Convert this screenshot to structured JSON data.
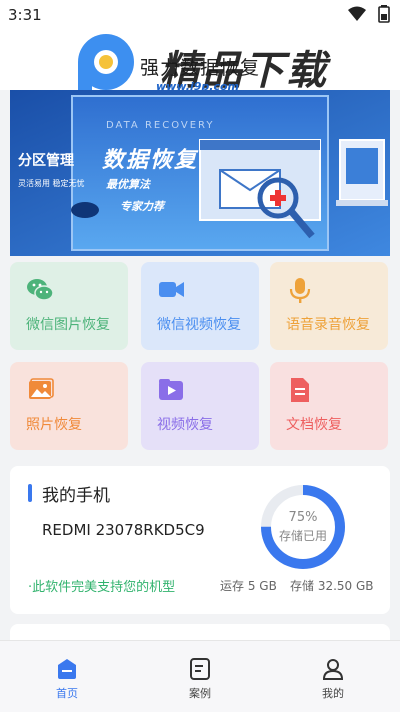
{
  "status_bar": {
    "time": "3:31"
  },
  "header": {
    "title": "强力数据恢复",
    "watermark_text": "精品下载",
    "watermark_url": "www.j9p.com"
  },
  "banner": {
    "title": "数据恢复",
    "subtitle": "DATA RECOVERY",
    "line1": "最优算法",
    "line2": "专家力荐",
    "left_text": "分区管理",
    "left_sub": "灵活易用 稳定无忧"
  },
  "tiles": [
    {
      "label": "微信图片恢复",
      "icon": "wechat-icon",
      "color": "#4db37a",
      "bg": "#dff0e6"
    },
    {
      "label": "微信视频恢复",
      "icon": "video-camera-icon",
      "color": "#4a8ef0",
      "bg": "#dbe7fa"
    },
    {
      "label": "语音录音恢复",
      "icon": "microphone-icon",
      "color": "#eea23a",
      "bg": "#f7ead8"
    },
    {
      "label": "照片恢复",
      "icon": "photo-icon",
      "color": "#f08a3a",
      "bg": "#f9e2dc"
    },
    {
      "label": "视频恢复",
      "icon": "video-play-icon",
      "color": "#8a6ee8",
      "bg": "#e5e0f8"
    },
    {
      "label": "文档恢复",
      "icon": "document-icon",
      "color": "#ee5f5f",
      "bg": "#f9e0e0"
    }
  ],
  "phone_card": {
    "title": "我的手机",
    "model": "REDMI 23078RKD5C9",
    "support_text": "·此软件完美支持您的机型",
    "ram": "运存 5 GB",
    "storage": "存储 32.50 GB",
    "usage_percent_text": "75%",
    "usage_percent": 75,
    "usage_label": "存储已用",
    "ring_color": "#3a78ee"
  },
  "nav": [
    {
      "label": "首页",
      "icon": "home-icon",
      "active": true
    },
    {
      "label": "案例",
      "icon": "case-icon",
      "active": false
    },
    {
      "label": "我的",
      "icon": "profile-icon",
      "active": false
    }
  ]
}
